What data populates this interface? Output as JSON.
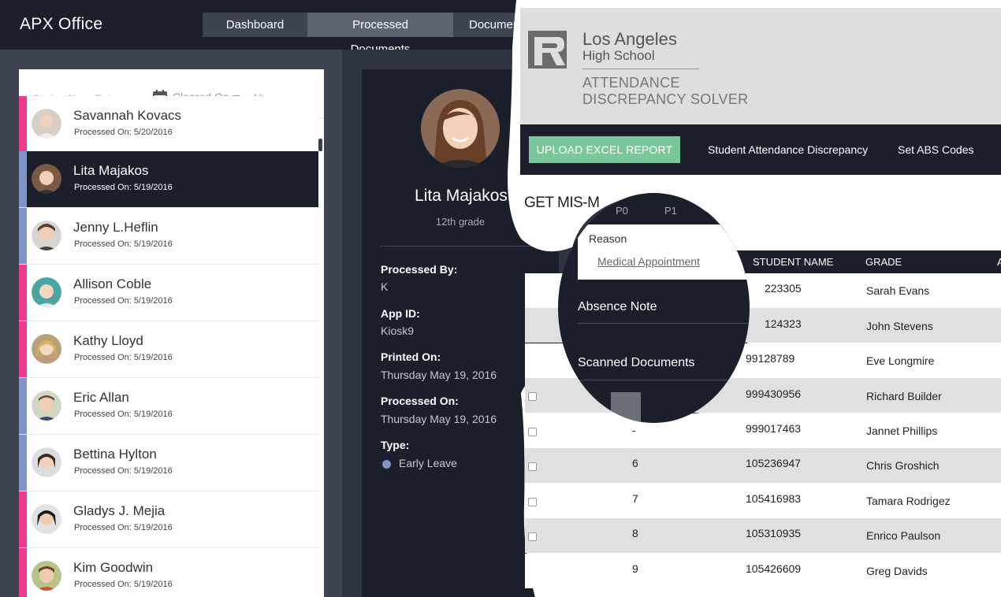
{
  "app": {
    "title": "APX Office"
  },
  "nav": {
    "tabs": [
      {
        "label": "Dashboard"
      },
      {
        "label": "Processed Documents"
      },
      {
        "label": "Documen"
      }
    ]
  },
  "filters": {
    "search_placeholder": "Student Name/Date",
    "cleared_on": "Cleared On",
    "all": "All"
  },
  "students": [
    {
      "name": "Savannah Kovacs",
      "date": "Processed On: 5/20/2016",
      "bar": "pink"
    },
    {
      "name": "Lita Majakos",
      "date": "Processed On: 5/19/2016",
      "bar": "blue"
    },
    {
      "name": "Jenny L.Heflin",
      "date": "Processed On: 5/19/2016",
      "bar": "blue"
    },
    {
      "name": "Allison Coble",
      "date": "Processed On: 5/19/2016",
      "bar": "pink"
    },
    {
      "name": "Kathy Lloyd",
      "date": "Processed On: 5/19/2016",
      "bar": "pink"
    },
    {
      "name": "Eric Allan",
      "date": "Processed On: 5/19/2016",
      "bar": "blue"
    },
    {
      "name": "Bettina Hylton",
      "date": "Processed On: 5/19/2016",
      "bar": "blue"
    },
    {
      "name": "Gladys J. Mejia",
      "date": "Processed On: 5/19/2016",
      "bar": "pink"
    },
    {
      "name": "Kim Goodwin",
      "date": "Processed On: 5/19/2016",
      "bar": "pink"
    }
  ],
  "detail": {
    "name": "Lita Majakos",
    "grade": "12th grade",
    "processed_by_label": "Processed By:",
    "processed_by": "K",
    "app_id_label": "App ID:",
    "app_id": "Kiosk9",
    "printed_on_label": "Printed On:",
    "printed_on": "Thursday May 19, 2016",
    "processed_on_label": "Processed On:",
    "processed_on": "Thursday May 19, 2016",
    "type_label": "Type:",
    "type": "Early Leave",
    "type_color": "#7d95c9"
  },
  "school": {
    "name_line1": "Los Angeles",
    "name_line2": "High School",
    "app_line1": "ATTENDANCE",
    "app_line2": "DISCREPANCY SOLVER"
  },
  "right_nav": {
    "upload": "UPLOAD EXCEL REPORT",
    "link1": "Student Attendance Discrepancy",
    "link2": "Set ABS Codes"
  },
  "section_title": "GET MIS-M",
  "popup": {
    "p0": "P0",
    "p1": "P1",
    "reason_label": "Reason",
    "reason_value": "Medical Appointment",
    "absence_note": "Absence Note",
    "scanned_documents": "Scanned Documents"
  },
  "table": {
    "headers": [
      "STUDENT NAME",
      "GRADE",
      "A"
    ],
    "rows": [
      {
        "num": "",
        "id": "223305",
        "name": "Sarah Evans"
      },
      {
        "num": "",
        "id": "124323",
        "name": "John Stevens"
      },
      {
        "num": "",
        "id": "99128789",
        "name": "Eve Longmire"
      },
      {
        "num": "",
        "id": "999430956",
        "name": "Richard Builder"
      },
      {
        "num": "-",
        "id": "999017463",
        "name": "Jannet Phillips"
      },
      {
        "num": "6",
        "id": "105236947",
        "name": "Chris Groshich"
      },
      {
        "num": "7",
        "id": "105416983",
        "name": "Tamara Rodrigez"
      },
      {
        "num": "8",
        "id": "105310935",
        "name": "Enrico Paulson"
      },
      {
        "num": "9",
        "id": "105426609",
        "name": "Greg Davids"
      }
    ]
  }
}
